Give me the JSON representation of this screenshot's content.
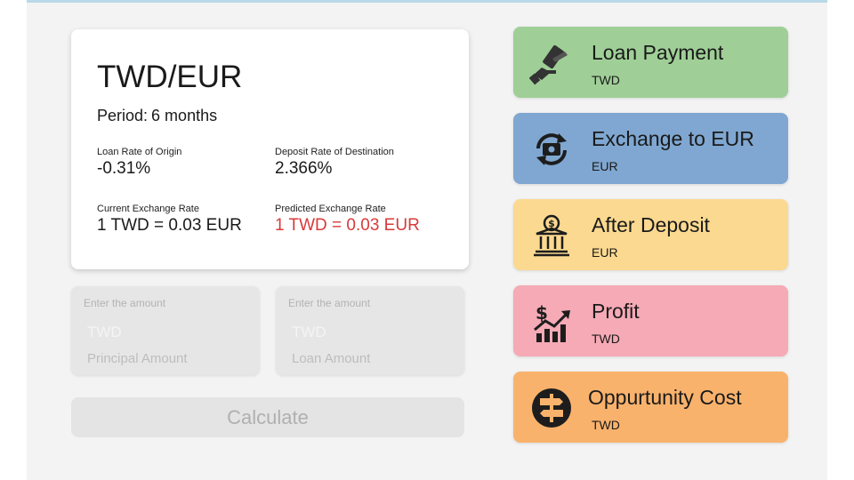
{
  "info": {
    "pair": "TWD/EUR",
    "period_label": "Period:",
    "period_value": "6 months",
    "loan_rate_label": "Loan Rate of Origin",
    "loan_rate_value": "-0.31%",
    "deposit_rate_label": "Deposit Rate of Destination",
    "deposit_rate_value": "2.366%",
    "current_rate_label": "Current Exchange Rate",
    "current_rate_value": "1 TWD = 0.03 EUR",
    "predicted_rate_label": "Predicted Exchange Rate",
    "predicted_rate_value": "1 TWD = 0.03 EUR"
  },
  "inputs": [
    {
      "placeholder": "Enter the amount",
      "currency": "TWD",
      "caption": "Principal Amount"
    },
    {
      "placeholder": "Enter the amount",
      "currency": "TWD",
      "caption": "Loan Amount"
    }
  ],
  "calculate_label": "Calculate",
  "results": [
    {
      "title": "Loan Payment",
      "currency": "TWD",
      "icon": "money-hand-icon",
      "color": "#9fcf97"
    },
    {
      "title": "Exchange to EUR",
      "currency": "EUR",
      "icon": "currency-exchange-icon",
      "color": "#7fa7d1"
    },
    {
      "title": "After Deposit",
      "currency": "EUR",
      "icon": "bank-icon",
      "color": "#fbd990"
    },
    {
      "title": "Profit",
      "currency": "TWD",
      "icon": "profit-chart-icon",
      "color": "#f5aab6"
    },
    {
      "title": "Oppurtunity Cost",
      "currency": "TWD",
      "icon": "signpost-icon",
      "color": "#f9b26c"
    }
  ],
  "colors": {
    "accent_red": "#d83a3a",
    "top_border": "#b9d8e8"
  }
}
